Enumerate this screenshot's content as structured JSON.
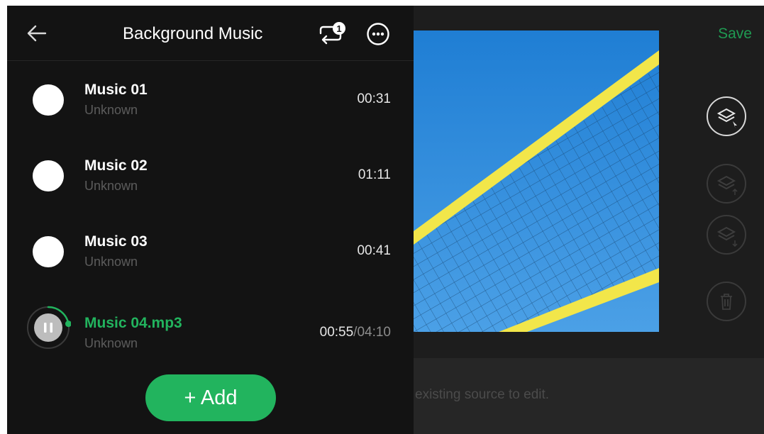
{
  "header": {
    "title": "Background Music",
    "loop_badge": "1"
  },
  "tracks": [
    {
      "name": "Music 01",
      "artist": "Unknown",
      "duration": "00:31"
    },
    {
      "name": "Music 02",
      "artist": "Unknown",
      "duration": "01:11"
    },
    {
      "name": "Music 03",
      "artist": "Unknown",
      "duration": "00:41"
    }
  ],
  "now_playing": {
    "name": "Music 04.mp3",
    "artist": "Unknown",
    "elapsed": "00:55",
    "separator": "/",
    "total": "04:10",
    "progress": 0.22
  },
  "add_label": "+ Add",
  "editor": {
    "save_label": "Save",
    "hint": "existing source to edit."
  },
  "colors": {
    "accent": "#22b45e",
    "save": "#1f9b52",
    "sky": "#2f86d6",
    "tape": "#f2e64a"
  },
  "icons": [
    "back-arrow-icon",
    "loop-icon",
    "more-icon",
    "layers-select-icon",
    "layer-up-icon",
    "layer-down-icon",
    "trash-icon",
    "pause-icon"
  ]
}
